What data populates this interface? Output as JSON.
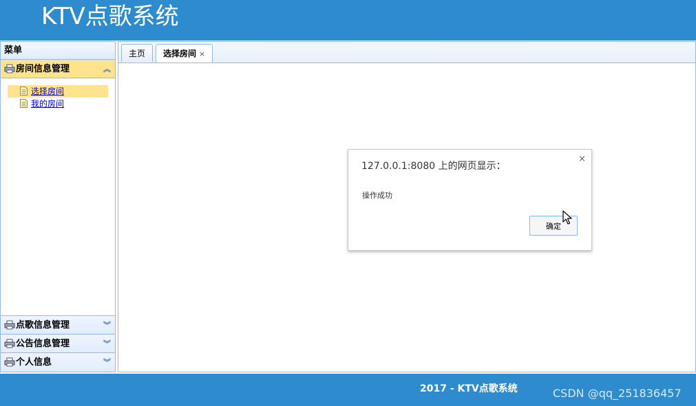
{
  "header": {
    "title": "KTV点歌系统"
  },
  "sidebar": {
    "title": "菜单",
    "accordions": [
      {
        "label": "房间信息管理",
        "icon": "printer-icon",
        "expanded": true,
        "items": [
          {
            "label": "选择房间",
            "icon": "document-icon",
            "selected": true
          },
          {
            "label": "我的房间",
            "icon": "document-icon",
            "selected": false
          }
        ]
      },
      {
        "label": "点歌信息管理",
        "icon": "printer-icon",
        "expanded": false
      },
      {
        "label": "公告信息管理",
        "icon": "printer-icon",
        "expanded": false
      },
      {
        "label": "个人信息",
        "icon": "printer-icon",
        "expanded": false
      }
    ]
  },
  "tabs": [
    {
      "label": "主页",
      "active": false,
      "closable": false
    },
    {
      "label": "选择房间",
      "active": true,
      "closable": true,
      "close_glyph": "×"
    }
  ],
  "dialog": {
    "title": "127.0.0.1:8080 上的网页显示：",
    "message": "操作成功",
    "ok_label": "确定",
    "close_glyph": "×"
  },
  "footer": {
    "text": "2017 - KTV点歌系统"
  },
  "watermark": "CSDN @qq_251836457",
  "colors": {
    "brand_blue": "#2e8bcd",
    "border": "#95b8e7",
    "selected": "#ffe48d"
  }
}
